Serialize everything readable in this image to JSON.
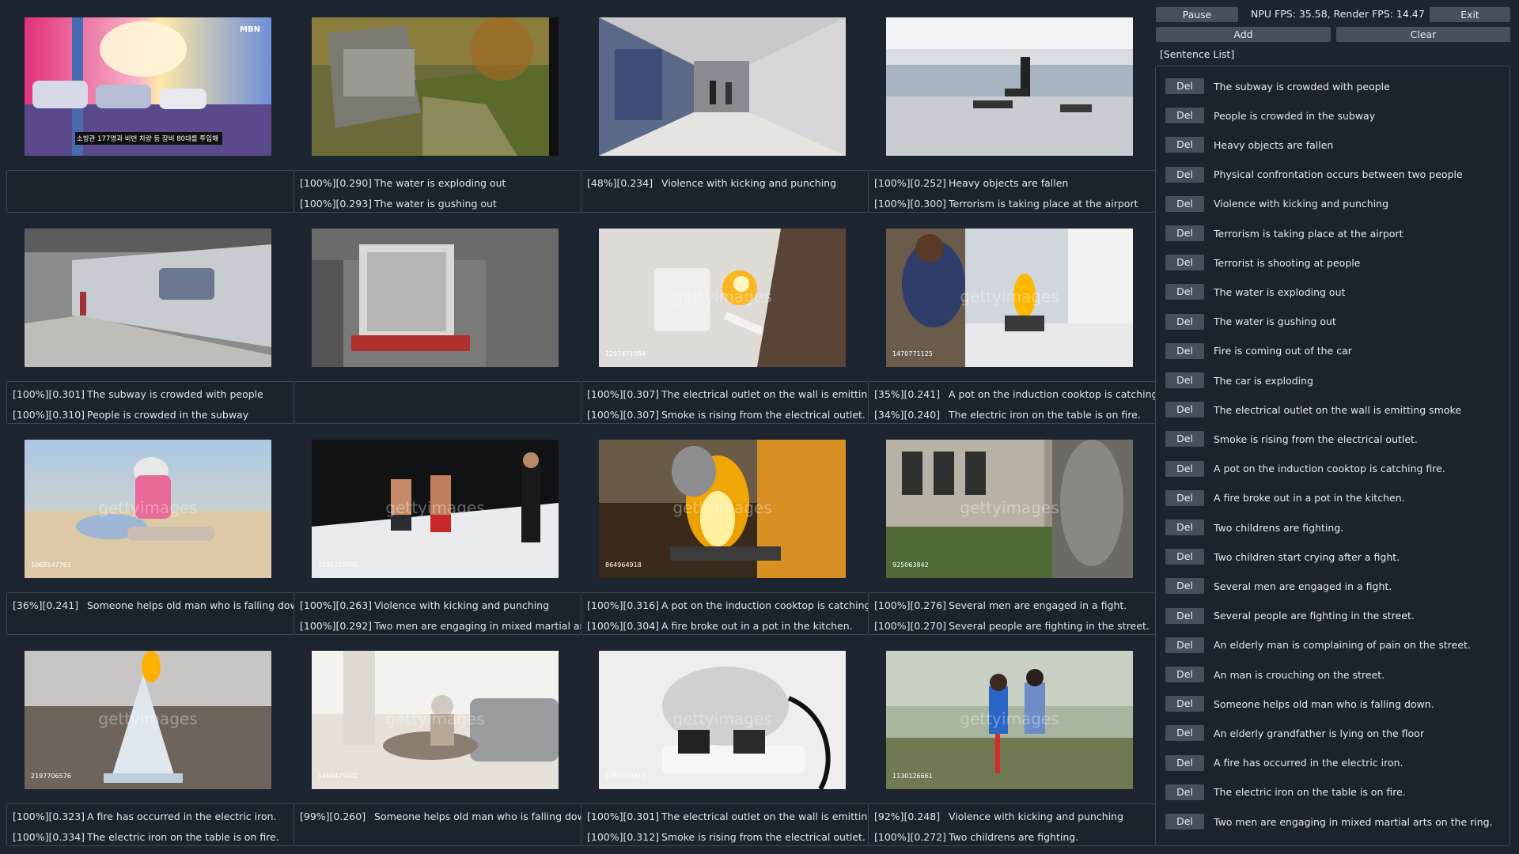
{
  "controls": {
    "pause_label": "Pause",
    "fps_text": "NPU FPS: 35.58, Render FPS: 14.47",
    "exit_label": "Exit",
    "add_label": "Add",
    "clear_label": "Clear"
  },
  "sentence_list_title": "[Sentence List]",
  "del_label": "Del",
  "sentences": [
    "The subway is crowded with people",
    "People is crowded in the subway",
    "Heavy objects are fallen",
    "Physical confrontation occurs between two people",
    "Violence with kicking and punching",
    "Terrorism is taking place at the airport",
    "Terrorist is shooting at people",
    "The water is exploding out",
    "The water is gushing out",
    "Fire is coming out of the car",
    "The car is exploding",
    "The electrical outlet on the wall is emitting smoke",
    "Smoke is rising from the electrical outlet.",
    "A pot on the induction cooktop is catching fire.",
    "A fire broke out in a pot in the kitchen.",
    "Two childrens are fighting.",
    "Two children start crying after a fight.",
    "Several men are engaged in a fight.",
    "Several people are fighting in the street.",
    "An elderly man is complaining of pain on the street.",
    "An man is crouching on the street.",
    "Someone helps old man who is falling down.",
    "An elderly grandfather is lying on the floor",
    "A fire has occurred in the electric iron.",
    "The electric iron on the table is on fire.",
    "Two men are engaging in mixed martial arts on the ring."
  ],
  "tiles": [
    {
      "name": "car-fire-parking",
      "overlay": "MBN",
      "caption": "소방관 177명과 비번 차량 등 장비 80대를 투입해",
      "results": []
    },
    {
      "name": "water-dam-forest",
      "overlay": "",
      "caption": "",
      "results": [
        {
          "score": "[100%][0.290]",
          "text": "The water is exploding out"
        },
        {
          "score": "[100%][0.293]",
          "text": "The water is gushing out"
        }
      ]
    },
    {
      "name": "subway-corridor",
      "overlay": "",
      "caption": "",
      "results": [
        {
          "score": "[48%][0.234]",
          "text": "Violence with kicking and punching"
        }
      ]
    },
    {
      "name": "airport-terror",
      "overlay": "",
      "caption": "",
      "results": [
        {
          "score": "[100%][0.252]",
          "text": "Heavy objects are fallen"
        },
        {
          "score": "[100%][0.300]",
          "text": "Terrorism is taking place at the airport"
        }
      ]
    },
    {
      "name": "subway-platform",
      "overlay": "",
      "caption": "",
      "results": [
        {
          "score": "[100%][0.301]",
          "text": "The subway is crowded with people"
        },
        {
          "score": "[100%][0.310]",
          "text": "People is crowded in the subway"
        }
      ]
    },
    {
      "name": "machinery-hall",
      "overlay": "",
      "caption": "",
      "results": []
    },
    {
      "name": "outlet-fire",
      "overlay": "1297471884",
      "caption": "",
      "results": [
        {
          "score": "[100%][0.307]",
          "text": "The electrical outlet on the wall is emitting smoke"
        },
        {
          "score": "[100%][0.307]",
          "text": "Smoke is rising from the electrical outlet."
        }
      ]
    },
    {
      "name": "kitchen-fire-man",
      "overlay": "1470771125",
      "caption": "",
      "results": [
        {
          "score": "[35%][0.241]",
          "text": "A pot on the induction cooktop is catching fire."
        },
        {
          "score": "[34%][0.240]",
          "text": "The electric iron on the table is on fire."
        }
      ]
    },
    {
      "name": "beach-elderly-help",
      "overlay": "1069147761",
      "caption": "",
      "results": [
        {
          "score": "[36%][0.241]",
          "text": "Someone helps old man who is falling down."
        }
      ]
    },
    {
      "name": "mma-ring",
      "overlay": "1795316690",
      "caption": "",
      "results": [
        {
          "score": "[100%][0.263]",
          "text": "Violence with kicking and punching"
        },
        {
          "score": "[100%][0.292]",
          "text": "Two men are engaging in mixed martial arts on the ring."
        }
      ]
    },
    {
      "name": "pot-fire-kitchen",
      "overlay": "864964918",
      "caption": "",
      "results": [
        {
          "score": "[100%][0.316]",
          "text": "A pot on the induction cooktop is catching fire."
        },
        {
          "score": "[100%][0.304]",
          "text": "A fire broke out in a pot in the kitchen."
        }
      ]
    },
    {
      "name": "street-men-fight",
      "overlay": "925063842",
      "caption": "",
      "results": [
        {
          "score": "[100%][0.276]",
          "text": "Several men are engaged in a fight."
        },
        {
          "score": "[100%][0.270]",
          "text": "Several people are fighting in the street."
        }
      ]
    },
    {
      "name": "iron-fire",
      "overlay": "2197706576",
      "caption": "",
      "results": [
        {
          "score": "[100%][0.323]",
          "text": "A fire has occurred in the electric iron."
        },
        {
          "score": "[100%][0.334]",
          "text": "The electric iron on the table is on fire."
        }
      ]
    },
    {
      "name": "elderly-floor",
      "overlay": "1469475002",
      "caption": "",
      "results": [
        {
          "score": "[99%][0.260]",
          "text": "Someone helps old man who is falling down."
        }
      ]
    },
    {
      "name": "power-strip-smoke",
      "overlay": "1291443815",
      "caption": "",
      "results": [
        {
          "score": "[100%][0.301]",
          "text": "The electrical outlet on the wall is emitting smoke"
        },
        {
          "score": "[100%][0.312]",
          "text": "Smoke is rising from the electrical outlet."
        }
      ]
    },
    {
      "name": "children-fight-park",
      "overlay": "1130126661",
      "caption": "",
      "results": [
        {
          "score": "[92%][0.248]",
          "text": "Violence with kicking and punching"
        },
        {
          "score": "[100%][0.272]",
          "text": "Two childrens are fighting."
        }
      ]
    }
  ],
  "watermark": "gettyimages"
}
